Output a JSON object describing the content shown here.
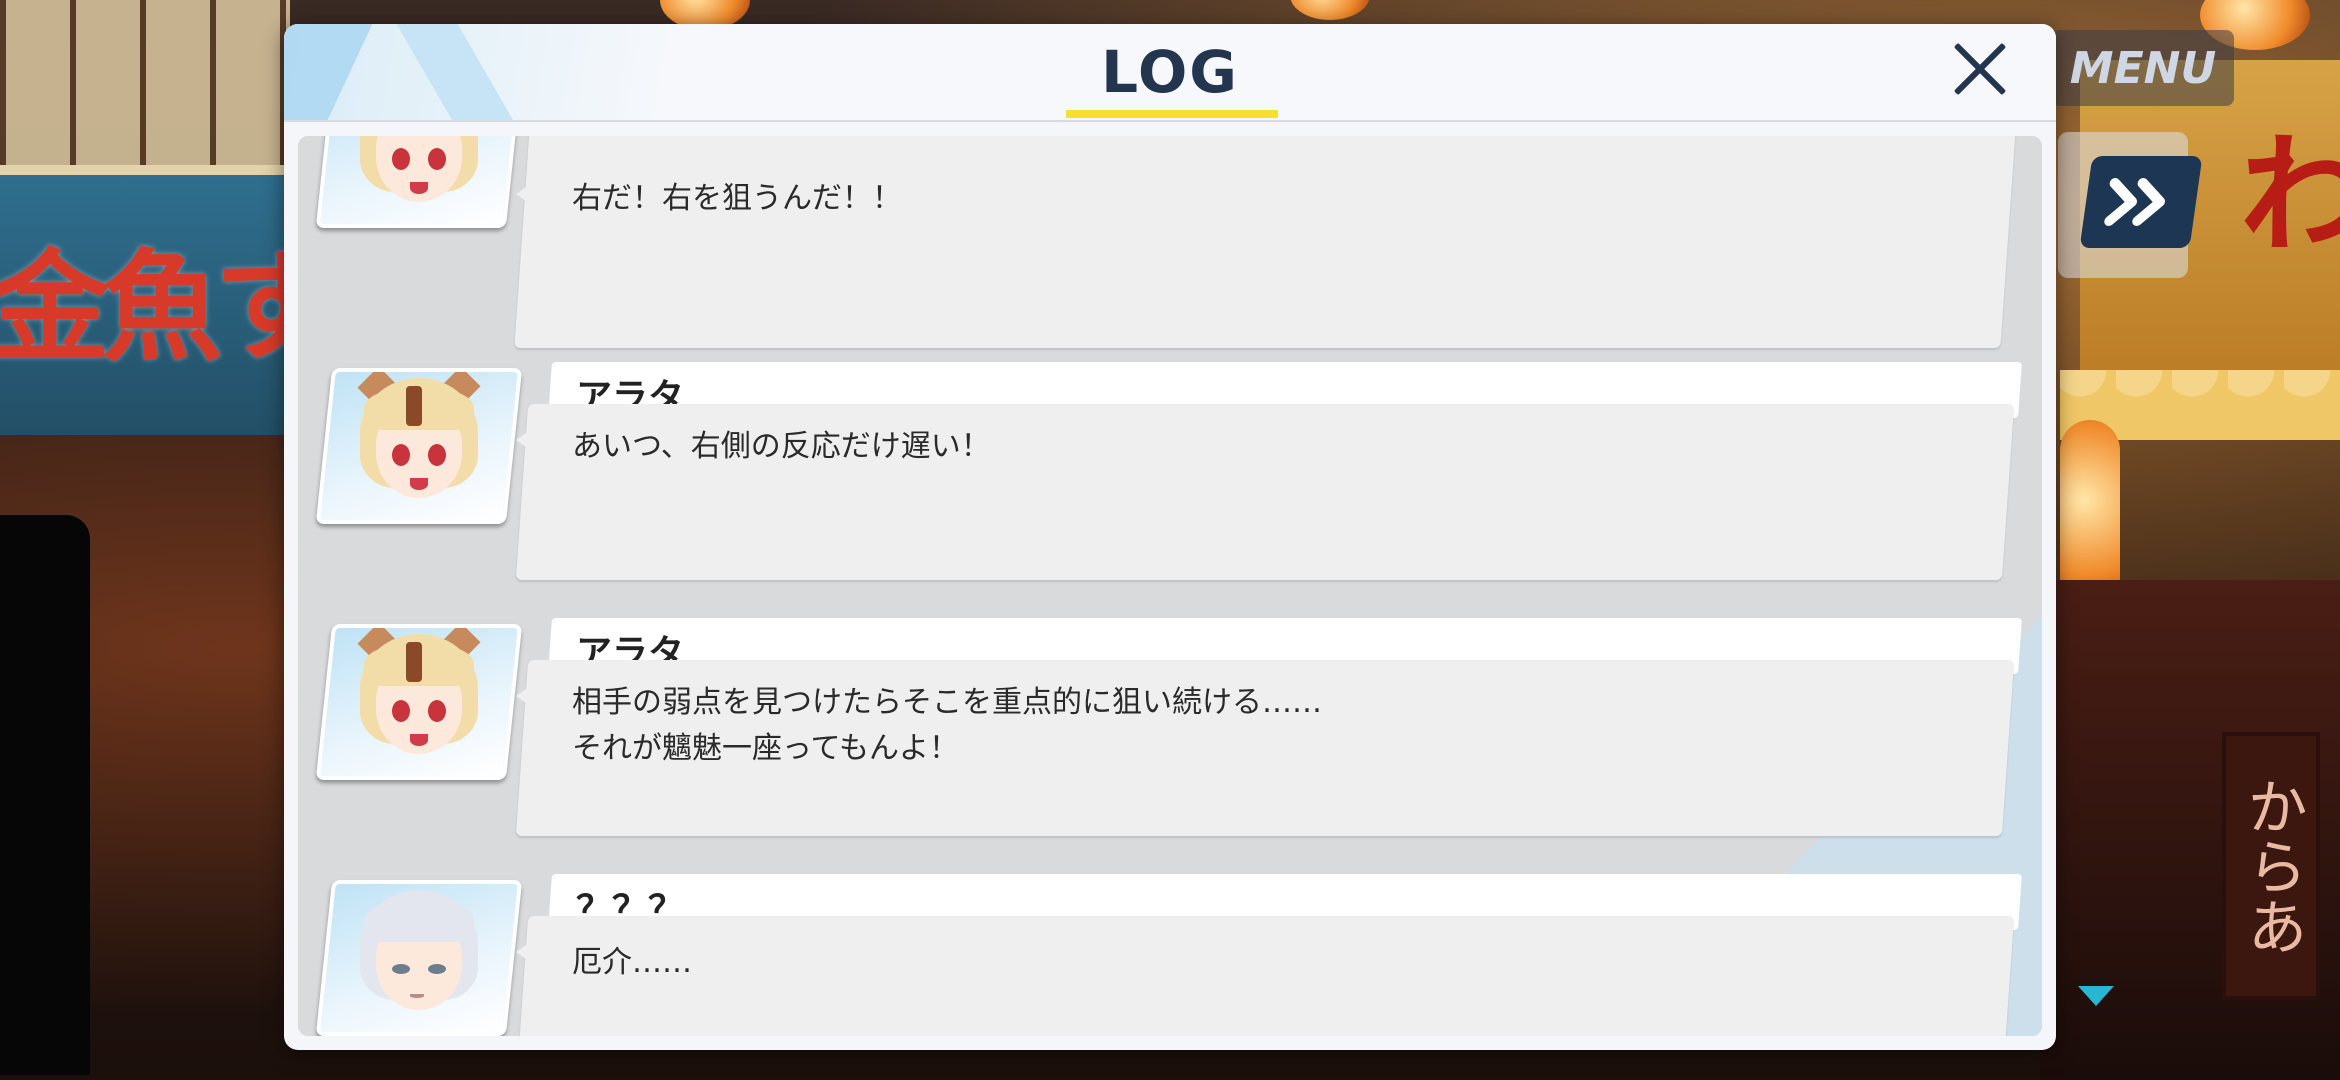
{
  "hud": {
    "menu_label": "MENU",
    "fast_forward_icon": "double-chevron-right-icon"
  },
  "log_dialog": {
    "title": "LOG",
    "close_icon": "close-icon",
    "accent_color": "#f5e12c",
    "entries": [
      {
        "speaker": "",
        "avatar": "arata-portrait",
        "text": "右だ！右を狙うんだ！！"
      },
      {
        "speaker": "アラタ",
        "avatar": "arata-portrait",
        "text": "あいつ、右側の反応だけ遅い！"
      },
      {
        "speaker": "アラタ",
        "avatar": "arata-portrait",
        "text": "相手の弱点を見つけたらそこを重点的に狙い続ける……\nそれが魑魅一座ってもんよ！"
      },
      {
        "speaker": "？？？",
        "avatar": "unknown-silver-hair-portrait",
        "text": "厄介……"
      }
    ]
  },
  "background": {
    "left_sign_text": "金魚す",
    "right_sign_text": "わ",
    "stall_sign_text": "からあ"
  }
}
